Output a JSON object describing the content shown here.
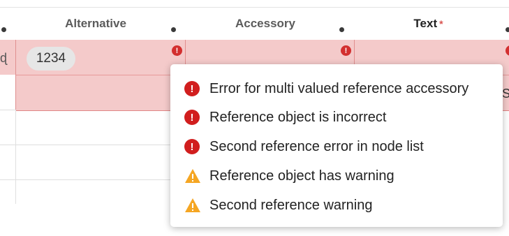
{
  "columns": [
    {
      "label": "Alternative",
      "required": false
    },
    {
      "label": "Accessory",
      "required": false
    },
    {
      "label": "Text",
      "required": true
    }
  ],
  "required_marker": "*",
  "row": {
    "chip_value": "1234"
  },
  "popup": {
    "items": [
      {
        "severity": "error",
        "icon": "error-icon",
        "text": "Error for multi valued reference accessory"
      },
      {
        "severity": "error",
        "icon": "error-icon",
        "text": "Reference object is incorrect"
      },
      {
        "severity": "error",
        "icon": "error-icon",
        "text": "Second reference error in node list"
      },
      {
        "severity": "warning",
        "icon": "warning-icon",
        "text": "Reference object has warning"
      },
      {
        "severity": "warning",
        "icon": "warning-icon",
        "text": "Second reference warning"
      }
    ]
  },
  "colors": {
    "error": "#d11e1e",
    "warning": "#f5a623",
    "error_row": "#f4caca"
  }
}
